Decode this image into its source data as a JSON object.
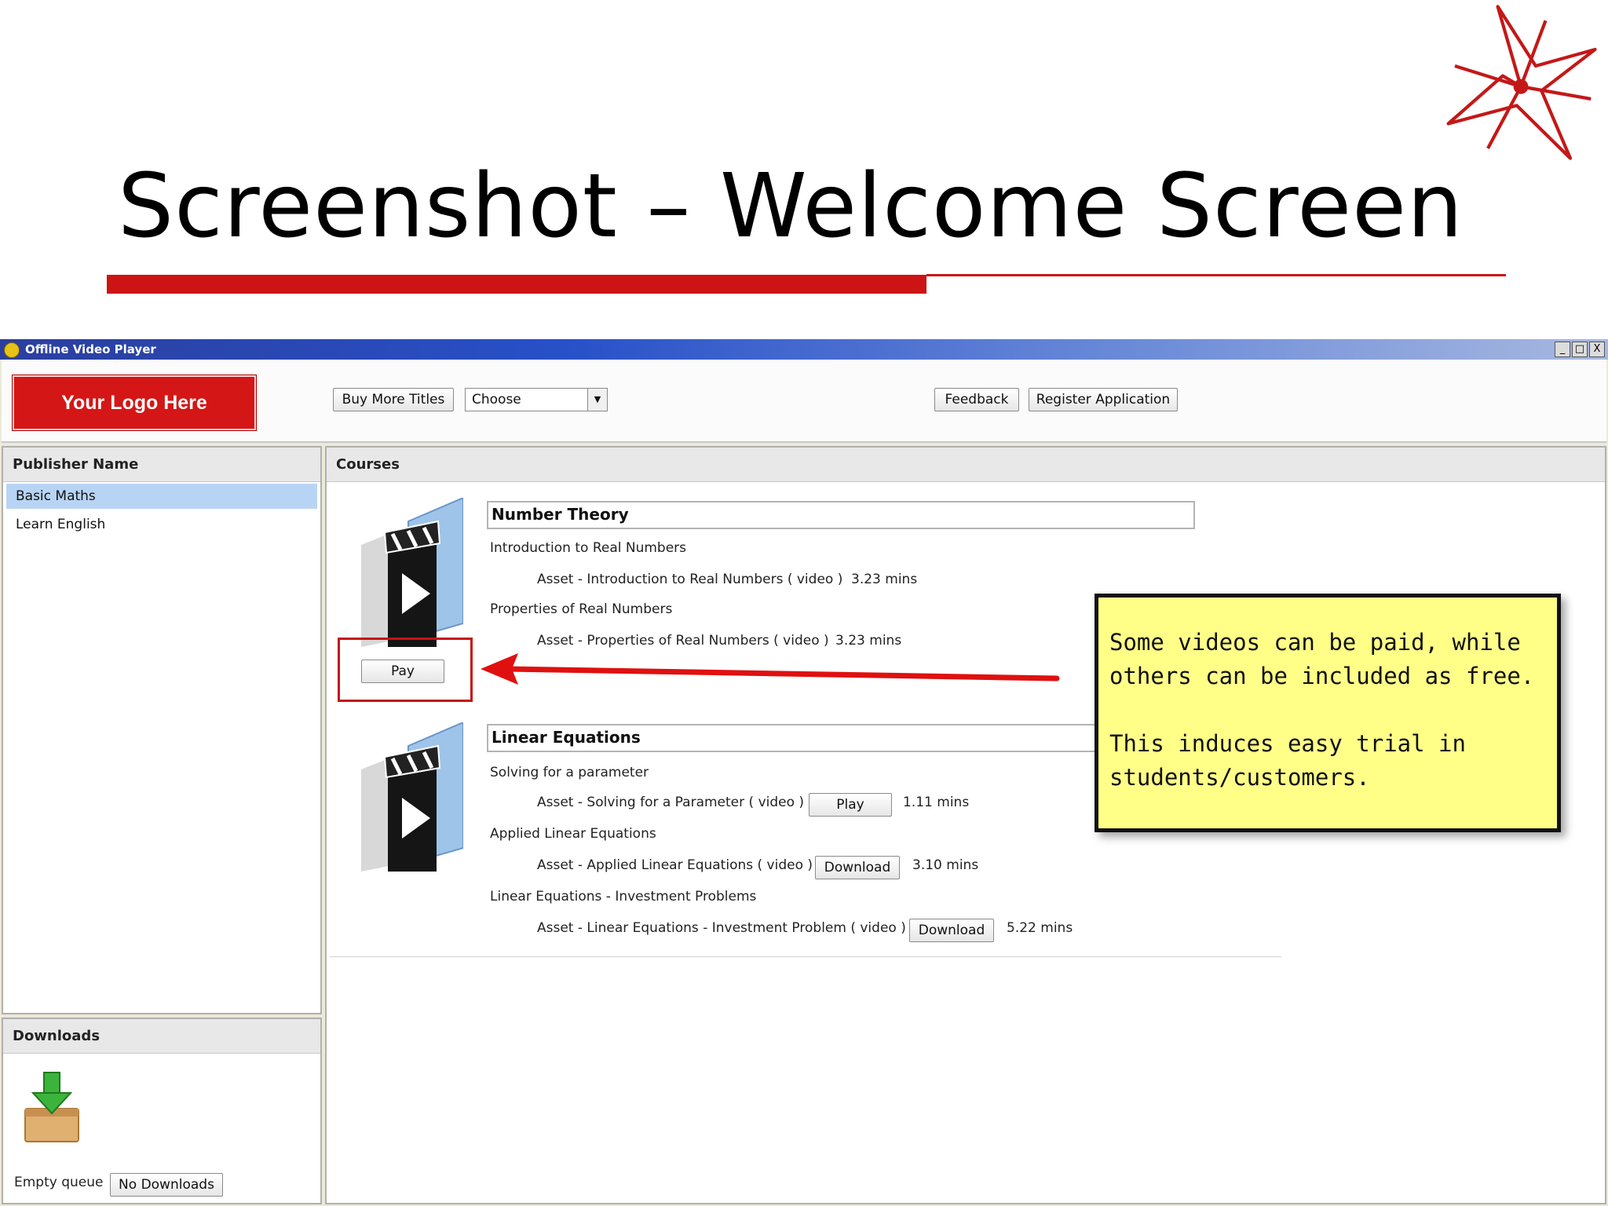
{
  "slide": {
    "title": "Screenshot – Welcome Screen",
    "accent_color": "#cc1414",
    "decoration_icon": "red-star-logo-icon"
  },
  "window": {
    "title": "Offline Video Player",
    "controls": [
      "_",
      "□",
      "X"
    ]
  },
  "toolbar": {
    "logo_text": "Your Logo Here",
    "buy_more_titles_label": "Buy More Titles",
    "choose_select_value": "Choose",
    "feedback_label": "Feedback",
    "register_label": "Register Application"
  },
  "publisher": {
    "header": "Publisher Name",
    "items": [
      {
        "label": "Basic Maths",
        "selected": true
      },
      {
        "label": "Learn English",
        "selected": false
      }
    ]
  },
  "downloads": {
    "header": "Downloads",
    "status": "Empty queue",
    "button_label": "No Downloads",
    "icon": "download-box-icon"
  },
  "courses": {
    "header": "Courses",
    "list": [
      {
        "title": "Number Theory",
        "thumbnail_icon": "video-clapper-icon",
        "action_label": "Pay",
        "topics": [
          {
            "name": "Introduction to Real Numbers",
            "asset": "Asset - Introduction to Real Numbers ( video )",
            "duration": "3.23 mins"
          },
          {
            "name": "Properties of Real Numbers",
            "asset": "Asset - Properties of Real Numbers ( video )",
            "duration": "3.23 mins"
          }
        ]
      },
      {
        "title": "Linear Equations",
        "thumbnail_icon": "video-clapper-icon",
        "topics": [
          {
            "name": "Solving for a parameter",
            "asset": "Asset - Solving for a Parameter ( video )",
            "action": "Play",
            "duration": "1.11 mins"
          },
          {
            "name": "Applied Linear Equations",
            "asset": "Asset - Applied Linear Equations ( video )",
            "action": "Download",
            "duration": "3.10 mins"
          },
          {
            "name": "Linear Equations - Investment Problems",
            "asset": "Asset - Linear Equations - Investment Problem ( video )",
            "action": "Download",
            "duration": "5.22 mins"
          }
        ]
      }
    ]
  },
  "callout": {
    "text": "Some videos can be paid, while\nothers can be included as free.\n\nThis induces easy trial in\nstudents/customers.",
    "background": "#ffff88"
  }
}
